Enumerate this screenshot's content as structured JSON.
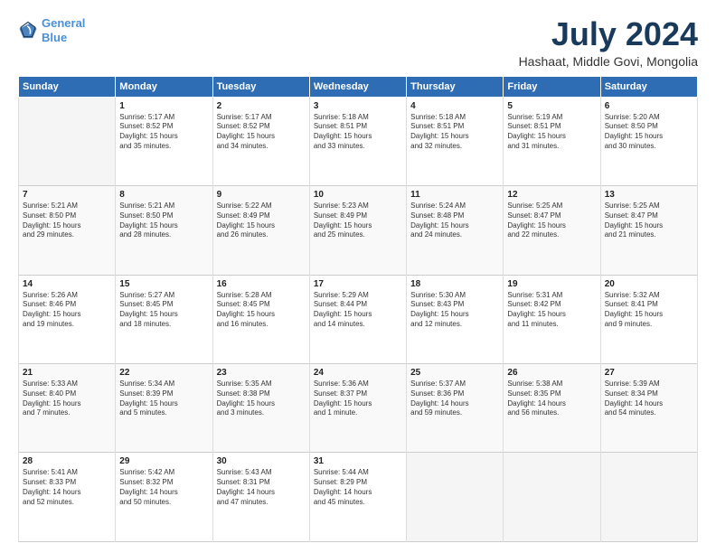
{
  "logo": {
    "line1": "General",
    "line2": "Blue"
  },
  "title": "July 2024",
  "subtitle": "Hashaat, Middle Govi, Mongolia",
  "days_of_week": [
    "Sunday",
    "Monday",
    "Tuesday",
    "Wednesday",
    "Thursday",
    "Friday",
    "Saturday"
  ],
  "weeks": [
    [
      {
        "day": "",
        "content": ""
      },
      {
        "day": "1",
        "content": "Sunrise: 5:17 AM\nSunset: 8:52 PM\nDaylight: 15 hours\nand 35 minutes."
      },
      {
        "day": "2",
        "content": "Sunrise: 5:17 AM\nSunset: 8:52 PM\nDaylight: 15 hours\nand 34 minutes."
      },
      {
        "day": "3",
        "content": "Sunrise: 5:18 AM\nSunset: 8:51 PM\nDaylight: 15 hours\nand 33 minutes."
      },
      {
        "day": "4",
        "content": "Sunrise: 5:18 AM\nSunset: 8:51 PM\nDaylight: 15 hours\nand 32 minutes."
      },
      {
        "day": "5",
        "content": "Sunrise: 5:19 AM\nSunset: 8:51 PM\nDaylight: 15 hours\nand 31 minutes."
      },
      {
        "day": "6",
        "content": "Sunrise: 5:20 AM\nSunset: 8:50 PM\nDaylight: 15 hours\nand 30 minutes."
      }
    ],
    [
      {
        "day": "7",
        "content": "Sunrise: 5:21 AM\nSunset: 8:50 PM\nDaylight: 15 hours\nand 29 minutes."
      },
      {
        "day": "8",
        "content": "Sunrise: 5:21 AM\nSunset: 8:50 PM\nDaylight: 15 hours\nand 28 minutes."
      },
      {
        "day": "9",
        "content": "Sunrise: 5:22 AM\nSunset: 8:49 PM\nDaylight: 15 hours\nand 26 minutes."
      },
      {
        "day": "10",
        "content": "Sunrise: 5:23 AM\nSunset: 8:49 PM\nDaylight: 15 hours\nand 25 minutes."
      },
      {
        "day": "11",
        "content": "Sunrise: 5:24 AM\nSunset: 8:48 PM\nDaylight: 15 hours\nand 24 minutes."
      },
      {
        "day": "12",
        "content": "Sunrise: 5:25 AM\nSunset: 8:47 PM\nDaylight: 15 hours\nand 22 minutes."
      },
      {
        "day": "13",
        "content": "Sunrise: 5:25 AM\nSunset: 8:47 PM\nDaylight: 15 hours\nand 21 minutes."
      }
    ],
    [
      {
        "day": "14",
        "content": "Sunrise: 5:26 AM\nSunset: 8:46 PM\nDaylight: 15 hours\nand 19 minutes."
      },
      {
        "day": "15",
        "content": "Sunrise: 5:27 AM\nSunset: 8:45 PM\nDaylight: 15 hours\nand 18 minutes."
      },
      {
        "day": "16",
        "content": "Sunrise: 5:28 AM\nSunset: 8:45 PM\nDaylight: 15 hours\nand 16 minutes."
      },
      {
        "day": "17",
        "content": "Sunrise: 5:29 AM\nSunset: 8:44 PM\nDaylight: 15 hours\nand 14 minutes."
      },
      {
        "day": "18",
        "content": "Sunrise: 5:30 AM\nSunset: 8:43 PM\nDaylight: 15 hours\nand 12 minutes."
      },
      {
        "day": "19",
        "content": "Sunrise: 5:31 AM\nSunset: 8:42 PM\nDaylight: 15 hours\nand 11 minutes."
      },
      {
        "day": "20",
        "content": "Sunrise: 5:32 AM\nSunset: 8:41 PM\nDaylight: 15 hours\nand 9 minutes."
      }
    ],
    [
      {
        "day": "21",
        "content": "Sunrise: 5:33 AM\nSunset: 8:40 PM\nDaylight: 15 hours\nand 7 minutes."
      },
      {
        "day": "22",
        "content": "Sunrise: 5:34 AM\nSunset: 8:39 PM\nDaylight: 15 hours\nand 5 minutes."
      },
      {
        "day": "23",
        "content": "Sunrise: 5:35 AM\nSunset: 8:38 PM\nDaylight: 15 hours\nand 3 minutes."
      },
      {
        "day": "24",
        "content": "Sunrise: 5:36 AM\nSunset: 8:37 PM\nDaylight: 15 hours\nand 1 minute."
      },
      {
        "day": "25",
        "content": "Sunrise: 5:37 AM\nSunset: 8:36 PM\nDaylight: 14 hours\nand 59 minutes."
      },
      {
        "day": "26",
        "content": "Sunrise: 5:38 AM\nSunset: 8:35 PM\nDaylight: 14 hours\nand 56 minutes."
      },
      {
        "day": "27",
        "content": "Sunrise: 5:39 AM\nSunset: 8:34 PM\nDaylight: 14 hours\nand 54 minutes."
      }
    ],
    [
      {
        "day": "28",
        "content": "Sunrise: 5:41 AM\nSunset: 8:33 PM\nDaylight: 14 hours\nand 52 minutes."
      },
      {
        "day": "29",
        "content": "Sunrise: 5:42 AM\nSunset: 8:32 PM\nDaylight: 14 hours\nand 50 minutes."
      },
      {
        "day": "30",
        "content": "Sunrise: 5:43 AM\nSunset: 8:31 PM\nDaylight: 14 hours\nand 47 minutes."
      },
      {
        "day": "31",
        "content": "Sunrise: 5:44 AM\nSunset: 8:29 PM\nDaylight: 14 hours\nand 45 minutes."
      },
      {
        "day": "",
        "content": ""
      },
      {
        "day": "",
        "content": ""
      },
      {
        "day": "",
        "content": ""
      }
    ]
  ]
}
